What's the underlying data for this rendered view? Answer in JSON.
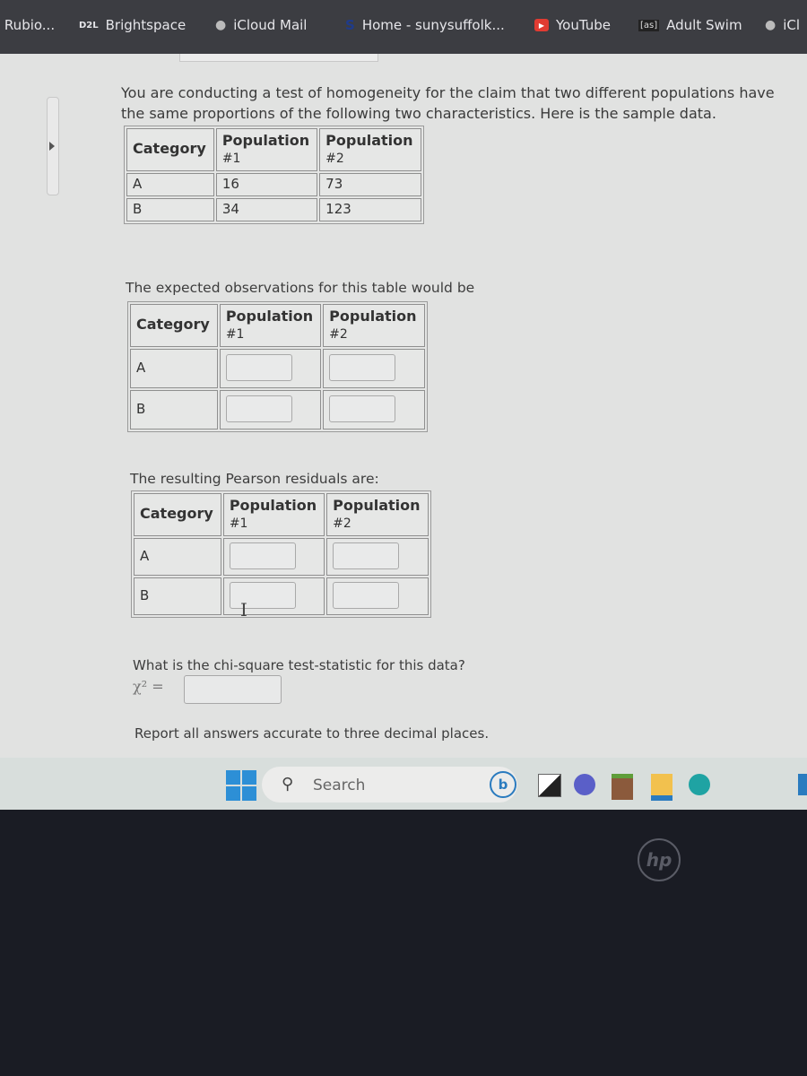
{
  "bookmarks": [
    {
      "label": "l Rubio...",
      "icon": "none"
    },
    {
      "label": "Brightspace",
      "icon": "d2l-logo",
      "icon_text": "D2L"
    },
    {
      "label": "iCloud Mail",
      "icon": "apple-logo"
    },
    {
      "label": "Home - sunysuffolk...",
      "icon": "suny-logo"
    },
    {
      "label": "YouTube",
      "icon": "youtube-logo"
    },
    {
      "label": "Adult Swim",
      "icon": "adult-swim-logo",
      "icon_text": "[as]"
    },
    {
      "label": "iCl",
      "icon": "apple-logo"
    }
  ],
  "question": {
    "prompt": "You are conducting a test of homogeneity for the claim that two different populations have the same proportions of the following two characteristics. Here is the sample data.",
    "observed_table": {
      "headers": [
        "Category",
        "Population",
        "#1",
        "Population",
        "#2"
      ],
      "rows": [
        {
          "category": "A",
          "pop1": "16",
          "pop2": "73"
        },
        {
          "category": "B",
          "pop1": "34",
          "pop2": "123"
        }
      ]
    },
    "expected_prompt": "The expected observations for this table would be",
    "expected_table": {
      "headers": [
        "Category",
        "Population",
        "#1",
        "Population",
        "#2"
      ],
      "rows": [
        {
          "category": "A",
          "pop1": "",
          "pop2": ""
        },
        {
          "category": "B",
          "pop1": "",
          "pop2": ""
        }
      ]
    },
    "residuals_prompt": "The resulting Pearson residuals are:",
    "residuals_table": {
      "headers": [
        "Category",
        "Population",
        "#1",
        "Population",
        "#2"
      ],
      "rows": [
        {
          "category": "A",
          "pop1": "",
          "pop2": ""
        },
        {
          "category": "B",
          "pop1": "",
          "pop2": ""
        }
      ]
    },
    "chi_prompt": "What is the chi-square test-statistic for this data?",
    "chi_label": "χ² =",
    "chi_value": "",
    "note": "Report all answers accurate to three decimal places."
  },
  "taskbar": {
    "search_placeholder": "Search",
    "apps": [
      "windows-start",
      "search",
      "bing-chat",
      "task-view",
      "teams-meet",
      "minecraft",
      "file-explorer",
      "edge"
    ]
  },
  "brand": {
    "laptop_logo": "hp"
  }
}
